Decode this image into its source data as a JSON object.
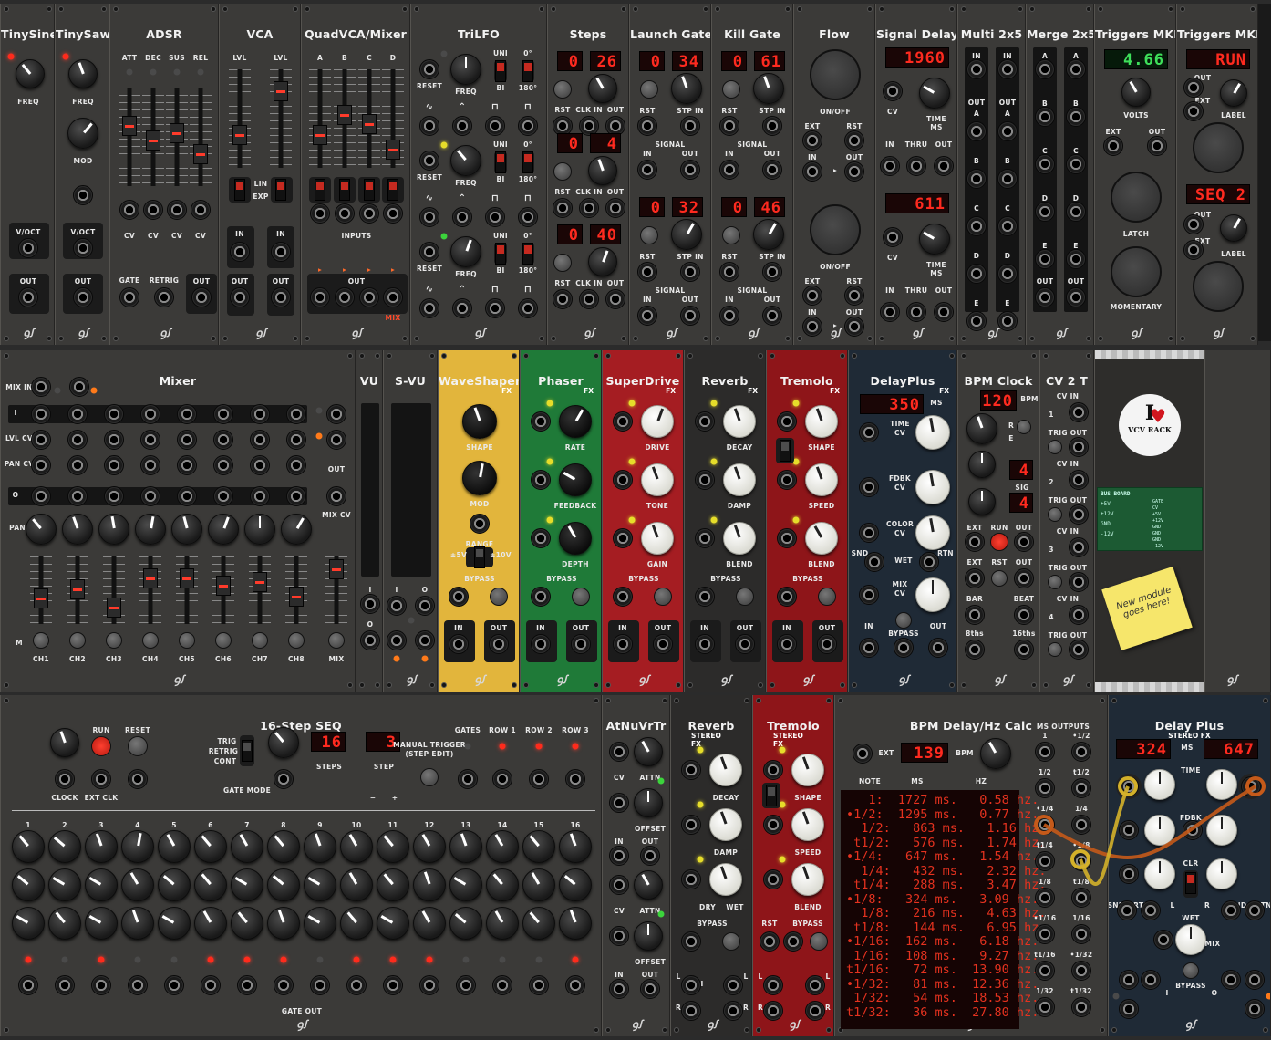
{
  "rows": [
    {
      "modules": [
        {
          "id": "tinysine",
          "title": "TinySine",
          "theme": "",
          "labels": [
            "FREQ",
            "V/OCT",
            "OUT"
          ]
        },
        {
          "id": "tinysawish",
          "title": "TinySawish",
          "theme": "",
          "labels": [
            "FREQ",
            "MOD",
            "V/OCT",
            "OUT"
          ]
        },
        {
          "id": "adsr",
          "title": "ADSR",
          "theme": "",
          "labels": [
            "ATT",
            "DEC",
            "SUS",
            "REL",
            "CV",
            "CV",
            "CV",
            "CV",
            "GATE",
            "RETRIG",
            "OUT"
          ]
        },
        {
          "id": "vca",
          "title": "VCA",
          "theme": "",
          "labels": [
            "LVL",
            "LVL",
            "LIN",
            "EXP",
            "IN",
            "IN",
            "OUT",
            "OUT"
          ]
        },
        {
          "id": "quadvca",
          "title": "QuadVCA/Mixer",
          "theme": "",
          "labels": [
            "A",
            "B",
            "C",
            "D",
            "INPUTS",
            "OUT",
            "MIX"
          ]
        },
        {
          "id": "trilfo",
          "title": "TriLFO",
          "theme": "",
          "labels": [
            "UNI",
            "BI",
            "0°",
            "180°",
            "RESET",
            "FREQ"
          ]
        },
        {
          "id": "steps",
          "title": "Steps",
          "theme": "",
          "labels": [
            "RST",
            "CLK IN",
            "OUT"
          ],
          "displays": [
            [
              "0",
              "26"
            ],
            [
              "0",
              "4"
            ],
            [
              "0",
              "40"
            ]
          ]
        },
        {
          "id": "launchgate",
          "title": "Launch Gate",
          "theme": "",
          "labels": [
            "RST",
            "STP IN",
            "SIGNAL",
            "IN",
            "OUT"
          ],
          "displays": [
            [
              "0",
              "34"
            ],
            [
              "0",
              "32"
            ]
          ]
        },
        {
          "id": "killgate",
          "title": "Kill Gate",
          "theme": "",
          "labels": [
            "RST",
            "STP IN",
            "SIGNAL",
            "IN",
            "OUT"
          ],
          "displays": [
            [
              "0",
              "61"
            ],
            [
              "0",
              "46"
            ]
          ]
        },
        {
          "id": "flow",
          "title": "Flow",
          "theme": "",
          "labels": [
            "ON/OFF",
            "EXT",
            "RST",
            "IN",
            "OUT"
          ]
        },
        {
          "id": "signaldelay",
          "title": "Signal Delay",
          "theme": "",
          "labels": [
            "CV",
            "TIME",
            "MS",
            "IN",
            "THRU",
            "OUT"
          ],
          "displays": [
            "1960",
            "611"
          ]
        },
        {
          "id": "multi2x5",
          "title": "Multi 2x5",
          "theme": "",
          "labels": [
            "IN",
            "OUT",
            "A",
            "B",
            "C",
            "D",
            "E"
          ]
        },
        {
          "id": "merge2x5",
          "title": "Merge 2x5",
          "theme": "",
          "labels": [
            "A",
            "B",
            "C",
            "D",
            "E",
            "OUT"
          ]
        },
        {
          "id": "triggersmki",
          "title": "Triggers MKI",
          "theme": "",
          "labels": [
            "VOLTS",
            "EXT",
            "OUT",
            "LATCH",
            "MOMENTARY"
          ],
          "displays": [
            "4.66"
          ]
        },
        {
          "id": "triggersmkii",
          "title": "Triggers MKII",
          "theme": "",
          "labels": [
            "OUT",
            "EXT",
            "LABEL"
          ],
          "displays": [
            "RUN",
            "SEQ 2"
          ]
        }
      ]
    },
    {
      "modules": [
        {
          "id": "mixer",
          "title": "Mixer",
          "theme": "",
          "labels": [
            "MIX IN",
            "L",
            "R",
            "I",
            "LVL CV",
            "PAN CV",
            "O",
            "PAN",
            "M",
            "OUT",
            "MIX CV"
          ],
          "channels": [
            "CH1",
            "CH2",
            "CH3",
            "CH4",
            "CH5",
            "CH6",
            "CH7",
            "CH8",
            "MIX"
          ]
        },
        {
          "id": "vu",
          "title": "VU",
          "theme": "",
          "labels": [
            "I",
            "O"
          ]
        },
        {
          "id": "svu",
          "title": "S-VU",
          "theme": "",
          "labels": [
            "I",
            "O",
            "L",
            "R"
          ]
        },
        {
          "id": "waveshaper",
          "title": "WaveShaper",
          "theme": "yellow",
          "fx": "FX",
          "labels": [
            "SHAPE",
            "MOD",
            "RANGE",
            "±5V",
            "±10V",
            "BYPASS",
            "IN",
            "OUT"
          ]
        },
        {
          "id": "phaser",
          "title": "Phaser",
          "theme": "green",
          "fx": "FX",
          "labels": [
            "RATE",
            "FEEDBACK",
            "DEPTH",
            "BYPASS",
            "IN",
            "OUT"
          ]
        },
        {
          "id": "superdrive",
          "title": "SuperDrive",
          "theme": "red",
          "fx": "FX",
          "labels": [
            "DRIVE",
            "TONE",
            "GAIN",
            "BYPASS",
            "IN",
            "OUT"
          ]
        },
        {
          "id": "reverb",
          "title": "Reverb",
          "theme": "dark",
          "fx": "FX",
          "labels": [
            "DECAY",
            "DAMP",
            "BLEND",
            "BYPASS",
            "IN",
            "OUT"
          ]
        },
        {
          "id": "tremolo",
          "title": "Tremolo",
          "theme": "dred",
          "fx": "FX",
          "labels": [
            "SHAPE",
            "SPEED",
            "BLEND",
            "BYPASS",
            "IN",
            "OUT"
          ]
        },
        {
          "id": "delayplus",
          "title": "DelayPlus",
          "theme": "navy",
          "fx": "FX",
          "labels": [
            "MS",
            "TIME",
            "CV",
            "FDBK",
            "COLOR",
            "SND",
            "WET",
            "RTN",
            "MIX",
            "BYPASS",
            "IN",
            "OUT"
          ],
          "displays": [
            "350"
          ]
        },
        {
          "id": "bpmclock",
          "title": "BPM Clock",
          "theme": "",
          "labels": [
            "BPM",
            "R",
            "E",
            "SIG",
            "EXT",
            "RUN",
            "OUT",
            "RST",
            "BAR",
            "BEAT",
            "8ths",
            "16ths"
          ],
          "displays": [
            "120",
            "4",
            "4"
          ]
        },
        {
          "id": "cv2t",
          "title": "CV 2 T",
          "theme": "",
          "labels": [
            "CV IN",
            "TRIG OUT",
            "1",
            "2",
            "3",
            "4"
          ]
        },
        {
          "id": "blank",
          "title": "",
          "theme": "dark",
          "labels": []
        }
      ]
    },
    {
      "modules": [
        {
          "id": "seq16",
          "title": "16-Step SEQ",
          "theme": "",
          "labels": [
            "RUN",
            "RESET",
            "TRIG",
            "RETRIG",
            "CONT",
            "GATE MODE",
            "CLOCK",
            "EXT CLK",
            "STEPS",
            "STEP",
            "MANUAL TRIGGER",
            "(STEP EDIT)",
            "GATES",
            "ROW 1",
            "ROW 2",
            "ROW 3",
            "GATE OUT"
          ],
          "displays": [
            "16",
            "3"
          ],
          "steps": [
            "1",
            "2",
            "3",
            "4",
            "5",
            "6",
            "7",
            "8",
            "9",
            "10",
            "11",
            "12",
            "13",
            "14",
            "15",
            "16"
          ]
        },
        {
          "id": "atnuvrtr",
          "title": "AtNuVrTr",
          "theme": "",
          "labels": [
            "CV",
            "ATTN",
            "OFFSET",
            "IN",
            "OUT"
          ]
        },
        {
          "id": "reverb_st",
          "title": "Reverb",
          "theme": "dark",
          "fx": "STEREO FX",
          "labels": [
            "DECAY",
            "DAMP",
            "DRY",
            "WET",
            "BYPASS",
            "L",
            "I",
            "O",
            "R"
          ]
        },
        {
          "id": "tremolo_st",
          "title": "Tremolo",
          "theme": "dred",
          "fx": "STEREO FX",
          "labels": [
            "SHAPE",
            "SPEED",
            "BLEND",
            "RST",
            "BYPASS",
            "L",
            "R"
          ]
        },
        {
          "id": "bpmcalc",
          "title": "BPM Delay/Hz Calc",
          "theme": "",
          "labels": [
            "EXT",
            "BPM",
            "NOTE",
            "MS",
            "HZ",
            "MS OUTPUTS"
          ],
          "displays": [
            "139"
          ],
          "table": [
            "   1:  1727 ms.   0.58 hz.",
            "•1/2:  1295 ms.   0.77 hz.",
            "  1/2:   863 ms.   1.16 hz.",
            " t1/2:   576 ms.   1.74 hz.",
            "•1/4:   647 ms.   1.54 hz.",
            "  1/4:   432 ms.   2.32 hz.",
            " t1/4:   288 ms.   3.47 hz.",
            "•1/8:   324 ms.   3.09 hz.",
            "  1/8:   216 ms.   4.63 hz.",
            " t1/8:   144 ms.   6.95 hz.",
            "•1/16:  162 ms.   6.18 hz.",
            " 1/16:  108 ms.   9.27 hz.",
            "t1/16:   72 ms.  13.90 hz.",
            "•1/32:   81 ms.  12.36 hz.",
            " 1/32:   54 ms.  18.53 hz.",
            "t1/32:   36 ms.  27.80 hz."
          ],
          "outputs": [
            "1",
            "•1/2",
            "1/2",
            "t1/2",
            "•1/4",
            "1/4",
            "t1/4",
            "•1/8",
            "1/8",
            "t1/8",
            "•1/16",
            "1/16",
            "t1/16",
            "•1/32",
            "1/32",
            "t1/32"
          ]
        },
        {
          "id": "delayplus_st",
          "title": "Delay Plus",
          "theme": "navy",
          "fx": "STEREO FX",
          "labels": [
            "MS",
            "TIME",
            "FDBK",
            "CLR",
            "SND",
            "RTN",
            "L",
            "R",
            "WET",
            "MIX",
            "BYPASS",
            "I",
            "O"
          ],
          "displays": [
            "324",
            "647"
          ]
        }
      ]
    }
  ],
  "sticky_note": "New module goes here!",
  "badge_line1": "I",
  "badge_line2": "VCV RACK",
  "bus_board": {
    "title": "BUS BOARD",
    "left": [
      "+5V",
      "+12V",
      "GND",
      "-12V"
    ],
    "right": [
      "GATE",
      "CV",
      "+5V",
      "+12V",
      "GND",
      "GND",
      "GND",
      "-12V"
    ]
  },
  "colors": {
    "panel": "#3b3a38",
    "yellow": "#e2b53c",
    "green": "#1f7a38",
    "red": "#a51d22",
    "navy": "#1f2a36",
    "segment": "#ff2a1f"
  }
}
